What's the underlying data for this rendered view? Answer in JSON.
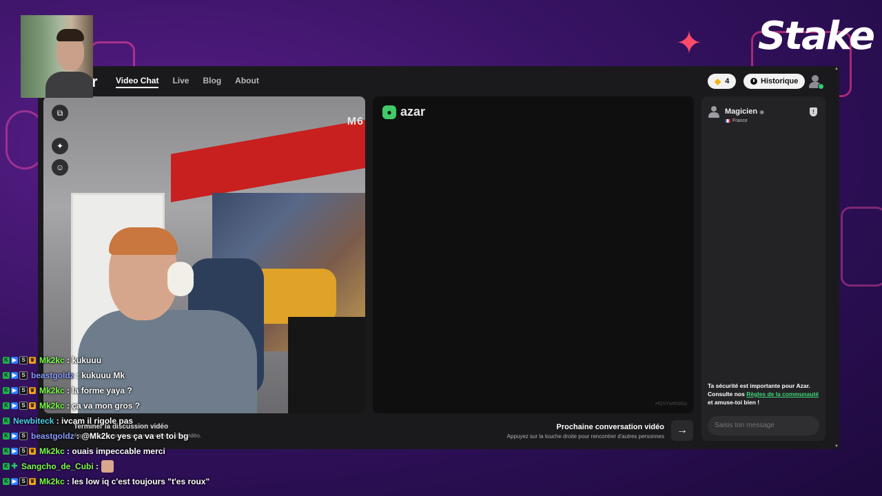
{
  "overlay": {
    "brand": "Stake"
  },
  "nav": {
    "logo_char": "r",
    "links": [
      "Video Chat",
      "Live",
      "Blog",
      "About"
    ],
    "active_index": 0,
    "gems_count": "4",
    "history_label": "Historique"
  },
  "video_left": {
    "watermark": "M6"
  },
  "video_right": {
    "brand": "azar",
    "session_id": "HQVYw85dGp"
  },
  "bottom": {
    "end_chat_title": "Terminer la discussion vidéo",
    "end_chat_sub": "Appuyez sur la touche pour mettre fin au chat vidéo.",
    "next_title": "Prochaine conversation vidéo",
    "next_sub": "Appuyez sur la touche droite pour rencontrer d'autres personnes"
  },
  "chat_panel": {
    "partner_name": "Magicien",
    "partner_country": "France",
    "safety_pre": "Ta sécurité est importante pour Azar. Consulte nos ",
    "safety_link": "Règles de la communauté",
    "safety_post": " et amuse-toi bien !",
    "input_placeholder": "Saisis ton message"
  },
  "twitch_chat": [
    {
      "user": "Mk2kc",
      "color": "#7CFC4C",
      "text": ": kukuuu"
    },
    {
      "user": "beastgoldz",
      "color": "#8A9BFF",
      "text": ": kukuuu Mk"
    },
    {
      "user": "Mk2kc",
      "color": "#7CFC4C",
      "text": ": la forme yaya ?"
    },
    {
      "user": "Mk2kc",
      "color": "#7CFC4C",
      "text": ": ça va mon gros ?"
    },
    {
      "user": "Newbiteck",
      "color": "#4FD0E8",
      "text": ": ivcam il rigole pas"
    },
    {
      "user": "beastgoldz",
      "color": "#8A9BFF",
      "text": ": @Mk2kc yes ça va et toi bg"
    },
    {
      "user": "Mk2kc",
      "color": "#7CFC4C",
      "text": ": ouais impeccable merci"
    },
    {
      "user": "Sangcho_de_Cubi",
      "color": "#7CFC4C",
      "text": ":"
    },
    {
      "user": "Mk2kc",
      "color": "#7CFC4C",
      "text": ": les low iq c'est toujours \"t'es roux\""
    }
  ]
}
